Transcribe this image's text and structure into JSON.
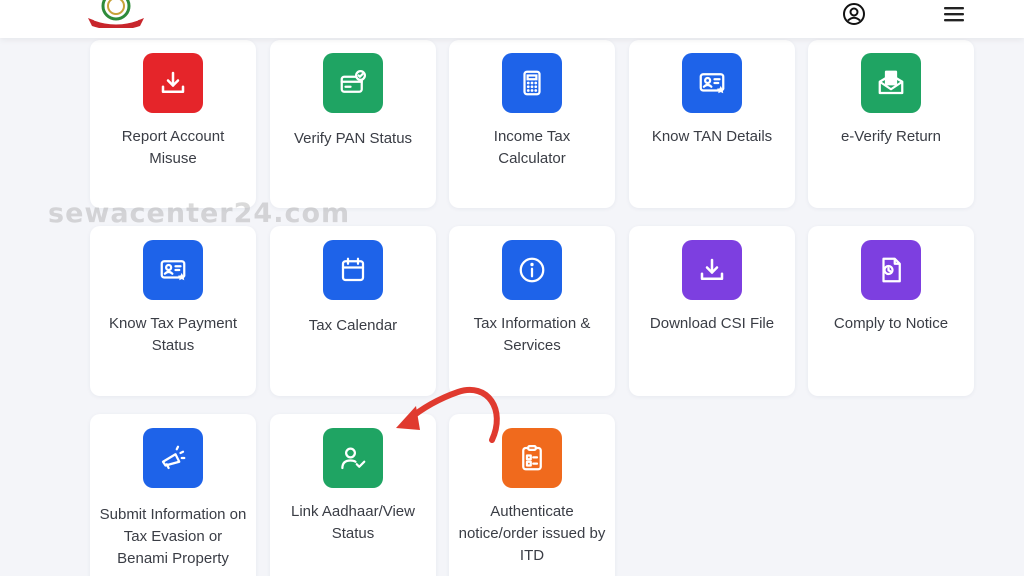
{
  "header": {
    "profile_icon": "user-circle-icon",
    "menu_icon": "hamburger-menu-icon"
  },
  "watermark": "sewacenter24.com",
  "services": [
    {
      "label": "Report Account Misuse",
      "icon": "download-icon",
      "color": "#e5252a"
    },
    {
      "label": "Verify PAN Status",
      "icon": "card-check-icon",
      "color": "#1fa463"
    },
    {
      "label": "Income Tax Calculator",
      "icon": "calculator-icon",
      "color": "#1e63e9"
    },
    {
      "label": "Know TAN Details",
      "icon": "id-card-star-icon",
      "color": "#1e63e9"
    },
    {
      "label": "e-Verify Return",
      "icon": "mail-document-icon",
      "color": "#1fa463"
    },
    {
      "label": "Know Tax Payment Status",
      "icon": "id-card-star-icon",
      "color": "#1e63e9"
    },
    {
      "label": "Tax Calendar",
      "icon": "calendar-icon",
      "color": "#1e63e9"
    },
    {
      "label": "Tax Information & Services",
      "icon": "info-icon",
      "color": "#1e63e9"
    },
    {
      "label": "Download CSI File",
      "icon": "download-icon",
      "color": "#7d3fe0"
    },
    {
      "label": "Comply to Notice",
      "icon": "document-clock-icon",
      "color": "#7d3fe0"
    },
    {
      "label": "Submit Information on Tax Evasion or Benami Property",
      "icon": "megaphone-icon",
      "color": "#1e63e9"
    },
    {
      "label": "Link Aadhaar/View Status",
      "icon": "user-check-icon",
      "color": "#1fa463"
    },
    {
      "label": "Authenticate notice/order issued by ITD",
      "icon": "clipboard-icon",
      "color": "#f06a1d"
    }
  ],
  "arrow_color": "#e03a2f"
}
